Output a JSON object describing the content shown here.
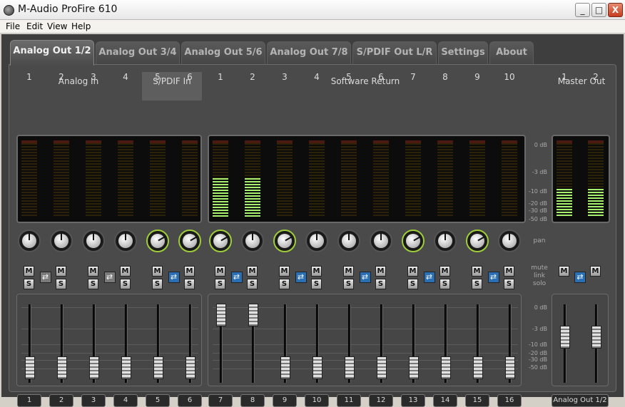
{
  "window": {
    "title": "M-Audio ProFire 610",
    "min": "_",
    "max": "□",
    "close": "X"
  },
  "menu": [
    "File",
    "Edit",
    "View",
    "Help"
  ],
  "tabs": [
    "Analog Out 1/2",
    "Analog Out 3/4",
    "Analog Out 5/6",
    "Analog Out 7/8",
    "S/PDIF Out L/R",
    "Settings",
    "About"
  ],
  "active_tab": 0,
  "groups": {
    "analog_in": "Analog In",
    "spdif_in": "S/PDIF In",
    "software_return": "Software Return",
    "master_out": "Master Out"
  },
  "input_channel_numbers": [
    "1",
    "2",
    "3",
    "4",
    "5",
    "6"
  ],
  "return_channel_numbers": [
    "1",
    "2",
    "3",
    "4",
    "5",
    "6",
    "7",
    "8",
    "9",
    "10"
  ],
  "master_channel_numbers": [
    "1",
    "2"
  ],
  "meter_scale": [
    "0 dB",
    "-3 dB",
    "-10 dB",
    "-20 dB",
    "-30 dB",
    "-50 dB"
  ],
  "fader_scale": [
    "0 dB",
    "-3 dB",
    "-10 dB",
    "-20 dB",
    "-30 dB",
    "-50 dB"
  ],
  "side_labels": {
    "pan": "pan",
    "mute": "mute",
    "link": "link",
    "solo": "solo"
  },
  "mute_label": "M",
  "solo_label": "S",
  "strip_labels": [
    "1",
    "2",
    "3",
    "4",
    "5",
    "6",
    "7",
    "8",
    "9",
    "10",
    "11",
    "12",
    "13",
    "14",
    "15",
    "16"
  ],
  "master_label": "Analog Out 1/2",
  "levels": {
    "inputs": [
      0,
      0,
      0,
      0,
      0,
      0
    ],
    "returns": [
      0.55,
      0.55,
      0,
      0,
      0,
      0,
      0,
      0,
      0,
      0
    ],
    "master": [
      0.4,
      0.4
    ]
  },
  "pan_indicator_on": [
    false,
    false,
    false,
    false,
    true,
    true,
    true,
    false,
    true,
    false,
    false,
    false,
    true,
    false,
    true,
    false
  ],
  "link_on": [
    false,
    false,
    true,
    true,
    true,
    true,
    true,
    true
  ],
  "master_link_on": true,
  "fader_levels": {
    "strips": [
      0.18,
      0.18,
      0.18,
      0.18,
      0.18,
      0.18,
      0.95,
      0.95,
      0.18,
      0.18,
      0.18,
      0.18,
      0.18,
      0.18,
      0.18,
      0.18
    ],
    "master": [
      0.62,
      0.62
    ]
  },
  "colors": {
    "meter_green": "#a8f070",
    "link_blue": "#2a6fb4",
    "pan_ring": "#9fce3a"
  }
}
